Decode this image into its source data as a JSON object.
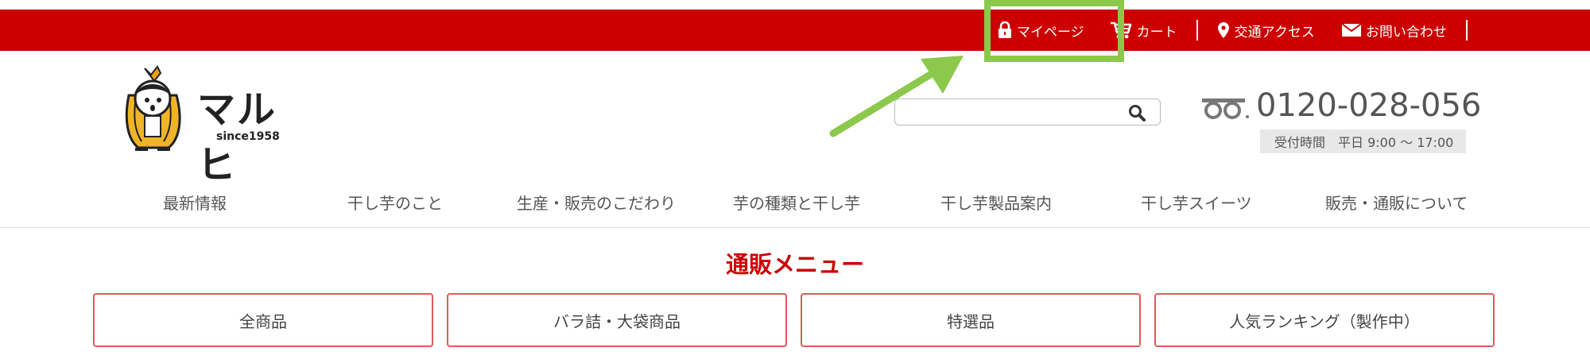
{
  "topbar": {
    "links": [
      {
        "label": "マイページ",
        "icon": "lock-icon"
      },
      {
        "label": "カート",
        "icon": "cart-icon"
      },
      {
        "label": "交通アクセス",
        "icon": "map-pin-icon"
      },
      {
        "label": "お問い合わせ",
        "icon": "mail-icon"
      }
    ],
    "highlight_color": "#8cc84b",
    "bar_color": "#cc0000"
  },
  "logo": {
    "title": "マルヒ",
    "since": "since1958"
  },
  "search": {
    "placeholder": "",
    "value": ""
  },
  "contact": {
    "phone": "0120-028-056",
    "hours": "受付時間　平日 9:00 ～ 17:00"
  },
  "nav": {
    "items": [
      "最新情報",
      "干し芋のこと",
      "生産・販売のこだわり",
      "芋の種類と干し芋",
      "干し芋製品案内",
      "干し芋スイーツ",
      "販売・通販について"
    ]
  },
  "shop_menu": {
    "title": "通販メニュー",
    "buttons": [
      "全商品",
      "バラ詰・大袋商品",
      "特選品",
      "人気ランキング（製作中）"
    ]
  }
}
